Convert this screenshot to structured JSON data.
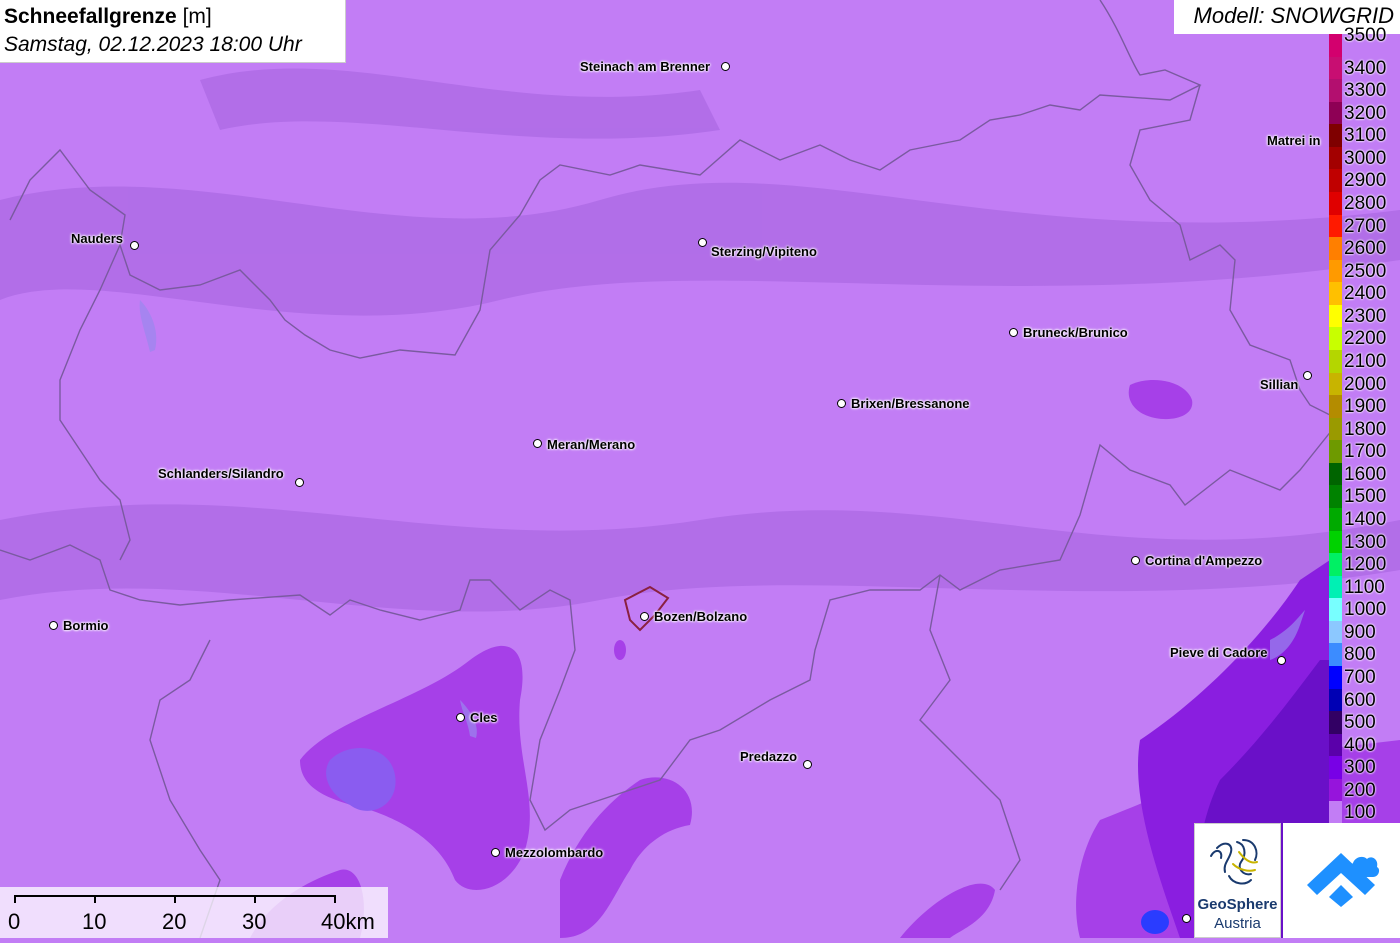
{
  "header": {
    "title": "Schneefallgrenze",
    "unit": "[m]",
    "datetime": "Samstag, 02.12.2023 18:00 Uhr"
  },
  "model": {
    "label": "Modell: SNOWGRID"
  },
  "cities": [
    {
      "name": "Steinach am Brenner"
    },
    {
      "name": "Nauders"
    },
    {
      "name": "Sterzing/Vipiteno"
    },
    {
      "name": "Matrei in"
    },
    {
      "name": "Bruneck/Brunico"
    },
    {
      "name": "Sillian"
    },
    {
      "name": "Brixen/Bressanone"
    },
    {
      "name": "Meran/Merano"
    },
    {
      "name": "Schlanders/Silandro"
    },
    {
      "name": "Cortina d'Ampezzo"
    },
    {
      "name": "Bormio"
    },
    {
      "name": "Bozen/Bolzano"
    },
    {
      "name": "Pieve di Cadore"
    },
    {
      "name": "Cles"
    },
    {
      "name": "Predazzo"
    },
    {
      "name": "Mezzolombardo"
    }
  ],
  "legend": {
    "entries": [
      {
        "label": "3500",
        "color": "#d3006e"
      },
      {
        "label": "3400",
        "color": "#c80e72"
      },
      {
        "label": "3300",
        "color": "#b30f6f"
      },
      {
        "label": "3200",
        "color": "#8e0055"
      },
      {
        "label": "3100",
        "color": "#7f0000"
      },
      {
        "label": "3000",
        "color": "#a30000"
      },
      {
        "label": "2900",
        "color": "#c00000"
      },
      {
        "label": "2800",
        "color": "#e00000"
      },
      {
        "label": "2700",
        "color": "#ff1a00"
      },
      {
        "label": "2600",
        "color": "#ff7f00"
      },
      {
        "label": "2500",
        "color": "#ff9a00"
      },
      {
        "label": "2400",
        "color": "#ffc000"
      },
      {
        "label": "2300",
        "color": "#ffff00"
      },
      {
        "label": "2200",
        "color": "#c8ff00"
      },
      {
        "label": "2100",
        "color": "#b4d600"
      },
      {
        "label": "2000",
        "color": "#c8b400"
      },
      {
        "label": "1900",
        "color": "#b48c00"
      },
      {
        "label": "1800",
        "color": "#9a9a00"
      },
      {
        "label": "1700",
        "color": "#6e9a00"
      },
      {
        "label": "1600",
        "color": "#006400"
      },
      {
        "label": "1500",
        "color": "#008200"
      },
      {
        "label": "1400",
        "color": "#00aa00"
      },
      {
        "label": "1300",
        "color": "#00d200"
      },
      {
        "label": "1200",
        "color": "#00f064"
      },
      {
        "label": "1100",
        "color": "#00f0b4"
      },
      {
        "label": "1000",
        "color": "#78ffff"
      },
      {
        "label": "900",
        "color": "#8cc8ff"
      },
      {
        "label": "800",
        "color": "#3c8cff"
      },
      {
        "label": "700",
        "color": "#0000ff"
      },
      {
        "label": "600",
        "color": "#0000b4"
      },
      {
        "label": "500",
        "color": "#320064"
      },
      {
        "label": "400",
        "color": "#5a00aa"
      },
      {
        "label": "300",
        "color": "#7800e6"
      },
      {
        "label": "200",
        "color": "#9614dc"
      },
      {
        "label": "100",
        "color": "#c27df5"
      }
    ]
  },
  "scale": {
    "labels": [
      "0",
      "10",
      "20",
      "30",
      "40km"
    ]
  },
  "logos": {
    "geosphere_line1": "GeoSphere",
    "geosphere_line2": "Austria"
  },
  "colors": {
    "base": "#c27df5",
    "level200": "#a640e8",
    "level300": "#8a1ee0",
    "level400": "#6a10c8",
    "level700": "#2a3cff"
  }
}
